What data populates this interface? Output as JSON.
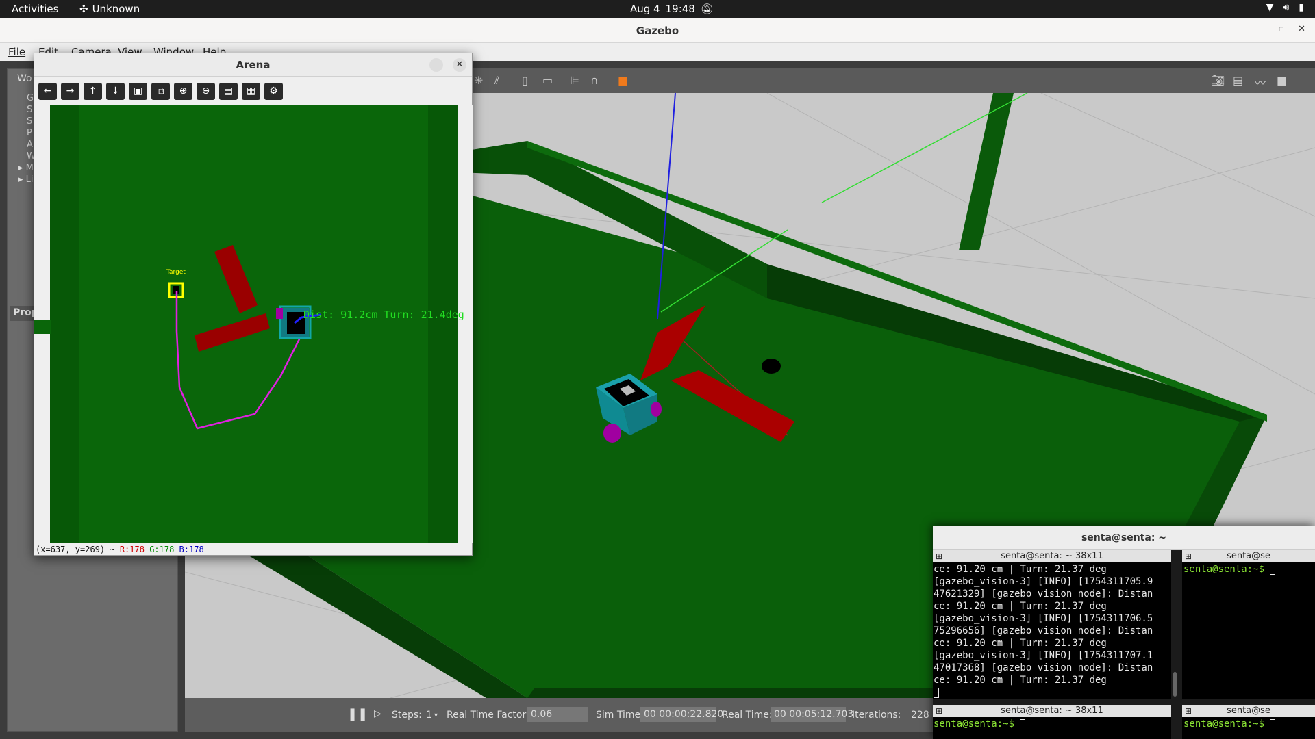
{
  "topbar": {
    "activities": "Activities",
    "app_name": "Unknown",
    "date": "Aug 4",
    "time": "19:48"
  },
  "gazebo": {
    "title": "Gazebo",
    "menu": [
      "File",
      "Edit",
      "Camera",
      "View",
      "Window",
      "Help"
    ],
    "left_panel": {
      "world_tab": "Wo",
      "tree": [
        "G",
        "S",
        "S",
        "P",
        "A",
        "W",
        "M",
        "Li"
      ],
      "properties_tab": "Prop"
    },
    "bottom": {
      "steps_label": "Steps:",
      "steps_value": "1",
      "rtf_label": "Real Time Factor:",
      "rtf_value": "0.06",
      "sim_time_label": "Sim Time:",
      "sim_time_value": "00 00:00:22.820",
      "real_time_label": "Real Time:",
      "real_time_value": "00 00:05:12.703",
      "iterations_label": "Iterations:",
      "iterations_value": "228"
    }
  },
  "arena": {
    "title": "Arena",
    "target_label": "Target",
    "overlay_text": "Dist: 91.2cm Turn: 21.4deg",
    "status": {
      "coords": "(x=637, y=269) ~",
      "r": "R:178",
      "g": "G:178",
      "b": "B:178"
    }
  },
  "terminal": {
    "title": "senta@senta: ~",
    "pane1_header": "senta@senta: ~ 38x11",
    "pane2_header": "senta@se",
    "pane3_header": "senta@senta: ~ 38x11",
    "pane4_header": "senta@se",
    "pane1_lines": [
      "ce: 91.20 cm | Turn: 21.37 deg",
      "[gazebo_vision-3] [INFO] [1754311705.9",
      "47621329] [gazebo_vision_node]: Distan",
      "ce: 91.20 cm | Turn: 21.37 deg",
      "[gazebo_vision-3] [INFO] [1754311706.5",
      "75296656] [gazebo_vision_node]: Distan",
      "ce: 91.20 cm | Turn: 21.37 deg",
      "[gazebo_vision-3] [INFO] [1754311707.1",
      "47017368] [gazebo_vision_node]: Distan",
      "ce: 91.20 cm | Turn: 21.37 deg"
    ],
    "prompt": "senta@senta:~$"
  }
}
